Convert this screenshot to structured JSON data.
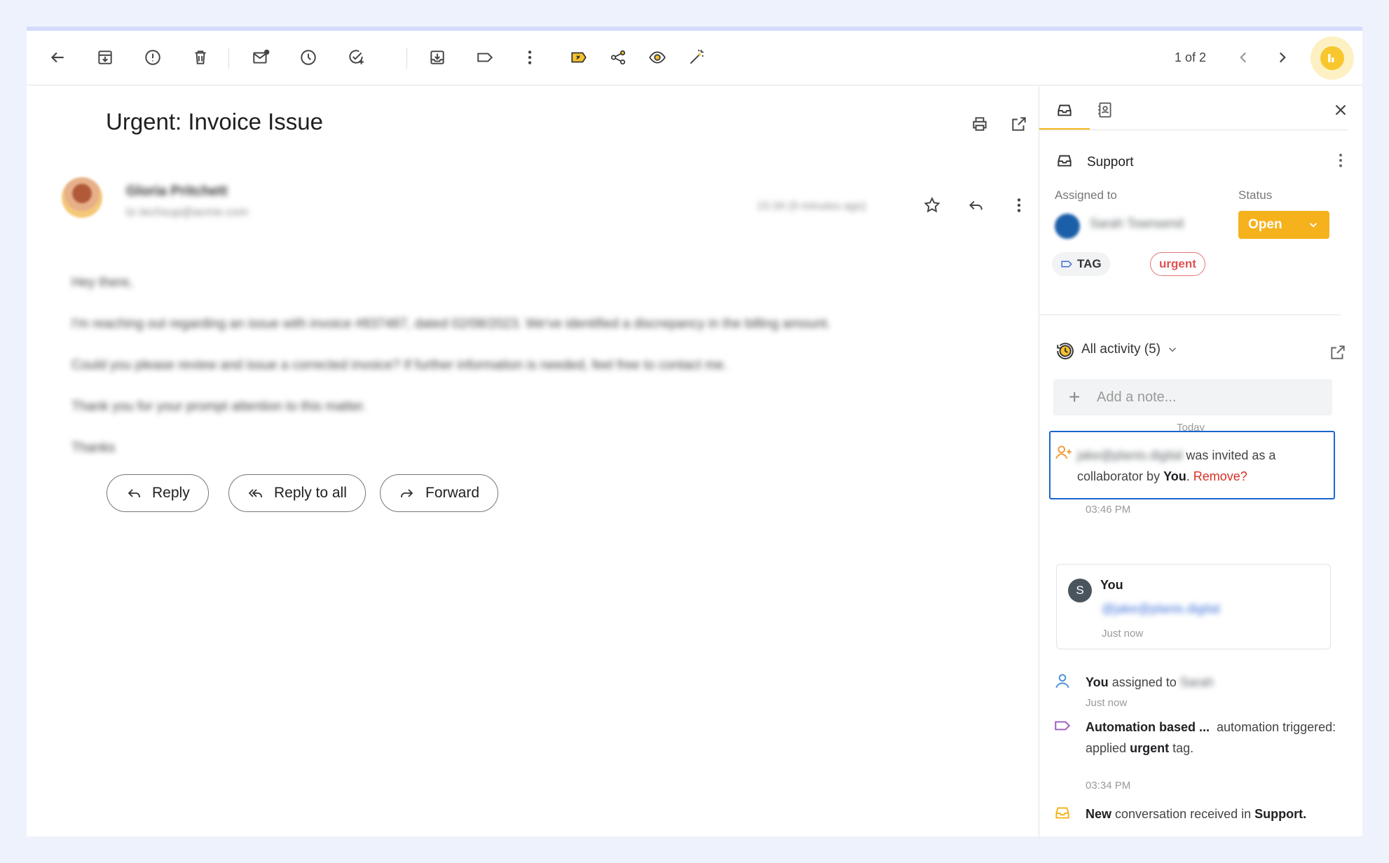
{
  "toolbar": {
    "pager": "1 of 2"
  },
  "email": {
    "subject": "Urgent: Invoice Issue",
    "sender_name": "Gloria Pritchett",
    "sender_to": "to techsup@acme.com",
    "time": "15:34 (9 minutes ago)",
    "body": [
      "Hey there,",
      "I'm reaching out regarding an issue with invoice #837487, dated 02/08/2023. We've identified a discrepancy in the billing amount.",
      "Could you please review and issue a corrected invoice? If further information is needed, feel free to contact me.",
      "Thank you for your prompt attention to this matter.",
      "Thanks"
    ],
    "reply_label": "Reply",
    "reply_all_label": "Reply to all",
    "forward_label": "Forward"
  },
  "sidebar": {
    "inbox_name": "Support",
    "assigned_label": "Assigned to",
    "assignee": "Sarah Townsend",
    "status_label": "Status",
    "status_value": "Open",
    "tag_chip": "TAG",
    "urgent_chip": "urgent",
    "activity_title": "All activity (5)",
    "note_placeholder": "Add a note...",
    "today_label": "Today",
    "events": {
      "invite": {
        "email": "jake@planis.digital",
        "text_a": "was invited as a",
        "text_b": "collaborator by",
        "who": "You",
        "remove": "Remove?",
        "time": "03:46 PM"
      },
      "note": {
        "author": "You",
        "mention": "@jake@planis.digital",
        "time": "Just now"
      },
      "assign": {
        "who": "You",
        "text": "assigned to",
        "target": "Sarah",
        "time": "Just now"
      },
      "automation": {
        "name": "Automation based ...",
        "text_a": "automation",
        "text_b": "triggered: applied",
        "tag": "urgent",
        "text_c": "tag.",
        "time": "03:34 PM"
      },
      "received": {
        "bold": "New",
        "text": "conversation received in",
        "inbox": "Support."
      }
    }
  },
  "colors": {
    "accent": "#f6b21c",
    "focus": "#1967d2",
    "danger": "#d93025"
  }
}
